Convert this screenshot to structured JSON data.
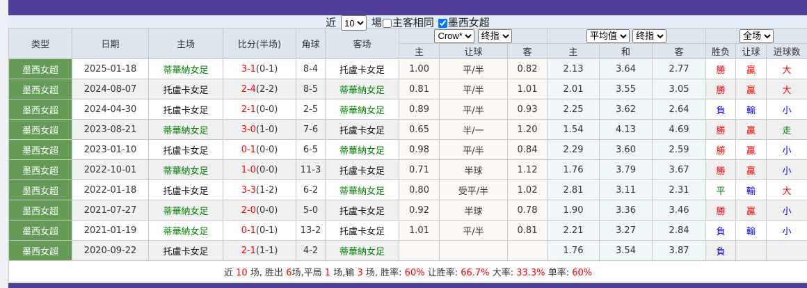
{
  "filter": {
    "prefix": "近",
    "count": "10",
    "suffix": "場",
    "same_home_label": "主客相同",
    "same_home_checked": false,
    "league_label": "墨西女超",
    "league_checked": true
  },
  "header": {
    "type": "类型",
    "date": "日期",
    "home": "主场",
    "score": "比分(半场)",
    "corner": "角球",
    "away": "客场",
    "company_select": "Crow*",
    "odds_select1": "终指",
    "avg_select": "平均值",
    "odds_select2": "终指",
    "period_select": "全场",
    "sub": [
      "主",
      "让球",
      "客",
      "主",
      "和",
      "客",
      "胜负",
      "让球",
      "进球数"
    ]
  },
  "colors": {
    "win": "#ff0000",
    "lose": "#0000ff",
    "draw": "#008000",
    "type_bg": "#639a56",
    "bar": "#523f9b"
  },
  "rows": [
    {
      "type": "墨西女超",
      "date": "2025-01-18",
      "home": "蒂華納女足",
      "score": "3-1",
      "half": "(0-1)",
      "corner": "8-4",
      "away": "托盧卡女足",
      "o_home": "1.00",
      "hcap": "平/半",
      "o_away": "0.82",
      "a_home": "2.13",
      "a_draw": "3.64",
      "a_away": "2.77",
      "r": "勝",
      "h": "贏",
      "g": "大"
    },
    {
      "type": "墨西女超",
      "date": "2024-08-07",
      "home": "托盧卡女足",
      "score": "2-4",
      "half": "(2-2)",
      "corner": "8-5",
      "away": "蒂華納女足",
      "o_home": "0.81",
      "hcap": "平/半",
      "o_away": "1.01",
      "a_home": "2.01",
      "a_draw": "3.55",
      "a_away": "3.05",
      "r": "勝",
      "h": "贏",
      "g": "大"
    },
    {
      "type": "墨西女超",
      "date": "2024-04-30",
      "home": "托盧卡女足",
      "score": "2-1",
      "half": "(0-0)",
      "corner": "2-5",
      "away": "蒂華納女足",
      "o_home": "0.89",
      "hcap": "平/半",
      "o_away": "0.93",
      "a_home": "2.25",
      "a_draw": "3.62",
      "a_away": "2.64",
      "r": "負",
      "h": "輸",
      "g": "小"
    },
    {
      "type": "墨西女超",
      "date": "2023-08-21",
      "home": "蒂華納女足",
      "score": "3-0",
      "half": "(1-0)",
      "corner": "7-6",
      "away": "托盧卡女足",
      "o_home": "0.65",
      "hcap": "半/一",
      "o_away": "1.20",
      "a_home": "1.54",
      "a_draw": "4.13",
      "a_away": "4.69",
      "r": "勝",
      "h": "贏",
      "g": "走"
    },
    {
      "type": "墨西女超",
      "date": "2023-01-10",
      "home": "托盧卡女足",
      "score": "0-1",
      "half": "(0-0)",
      "corner": "6-5",
      "away": "蒂華納女足",
      "o_home": "0.98",
      "hcap": "平/半",
      "o_away": "0.84",
      "a_home": "2.29",
      "a_draw": "3.60",
      "a_away": "2.59",
      "r": "勝",
      "h": "贏",
      "g": "小"
    },
    {
      "type": "墨西女超",
      "date": "2022-10-01",
      "home": "蒂華納女足",
      "score": "1-0",
      "half": "(0-0)",
      "corner": "11-3",
      "away": "托盧卡女足",
      "o_home": "0.71",
      "hcap": "半球",
      "o_away": "1.12",
      "a_home": "1.76",
      "a_draw": "3.79",
      "a_away": "3.67",
      "r": "勝",
      "h": "贏",
      "g": "小"
    },
    {
      "type": "墨西女超",
      "date": "2022-01-18",
      "home": "托盧卡女足",
      "score": "3-3",
      "half": "(1-2)",
      "corner": "6-2",
      "away": "蒂華納女足",
      "o_home": "0.80",
      "hcap": "受平/半",
      "o_away": "1.02",
      "a_home": "2.81",
      "a_draw": "3.11",
      "a_away": "2.31",
      "r": "平",
      "h": "輸",
      "g": "大"
    },
    {
      "type": "墨西女超",
      "date": "2021-07-27",
      "home": "蒂華納女足",
      "score": "2-0",
      "half": "(0-0)",
      "corner": "5-0",
      "away": "托盧卡女足",
      "o_home": "0.92",
      "hcap": "半球",
      "o_away": "0.78",
      "a_home": "1.90",
      "a_draw": "3.36",
      "a_away": "3.46",
      "r": "勝",
      "h": "贏",
      "g": "小"
    },
    {
      "type": "墨西女超",
      "date": "2021-01-19",
      "home": "蒂華納女足",
      "score": "0-1",
      "half": "(0-1)",
      "corner": "13-2",
      "away": "托盧卡女足",
      "o_home": "1.01",
      "hcap": "平/半",
      "o_away": "0.81",
      "a_home": "2.21",
      "a_draw": "3.27",
      "a_away": "2.84",
      "r": "負",
      "h": "輸",
      "g": "小"
    },
    {
      "type": "墨西女超",
      "date": "2020-09-22",
      "home": "托盧卡女足",
      "score": "2-1",
      "half": "(1-1)",
      "corner": "4-2",
      "away": "蒂華納女足",
      "o_home": "",
      "hcap": "",
      "o_away": "",
      "a_home": "1.76",
      "a_draw": "3.54",
      "a_away": "3.87",
      "r": "負",
      "h": "",
      "g": ""
    }
  ],
  "summary": {
    "t1": "近",
    "games": "10",
    "t2": "场, 胜出",
    "wins": "6",
    "t3": "场,平局",
    "draws": "1",
    "t4": "场,输",
    "losses": "3",
    "t5": "场, 胜率:",
    "win_rate": "60%",
    "t6": "让胜率:",
    "hcap_rate": "66.7%",
    "t7": "大率:",
    "over_rate": "33.3%",
    "t8": "单率:",
    "odd_rate": "60%"
  }
}
